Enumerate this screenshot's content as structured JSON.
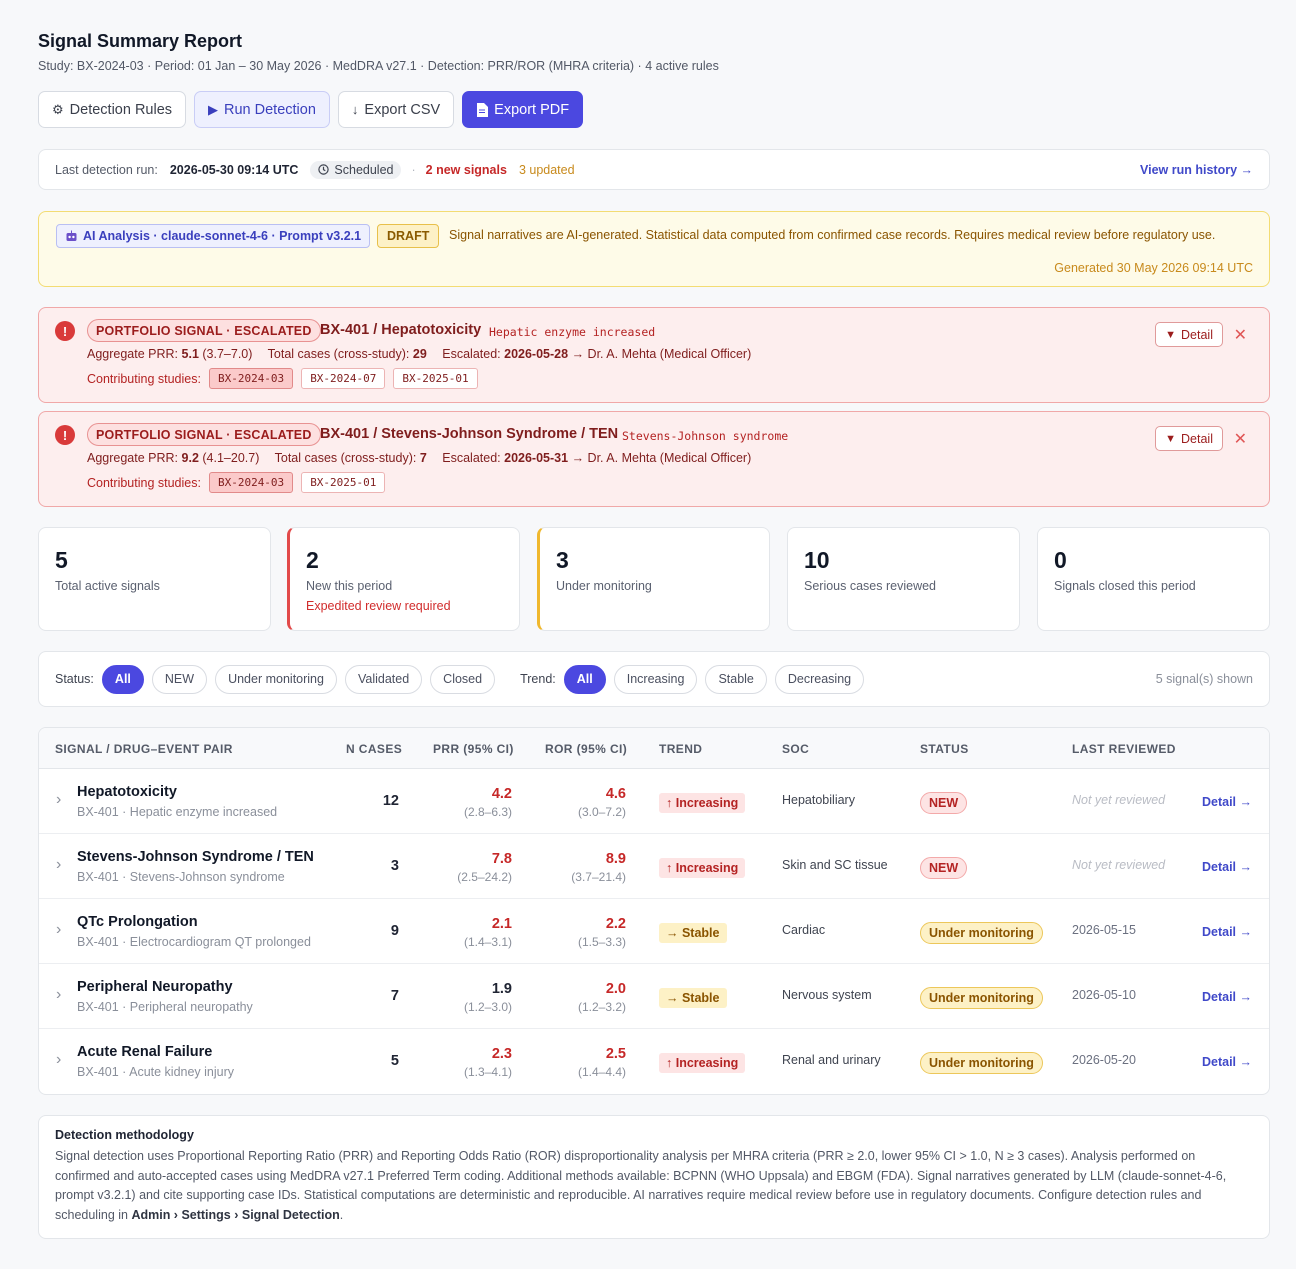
{
  "header": {
    "title": "Signal Summary Report",
    "subtitle": "Study: BX-2024-03  ·  Period: 01 Jan – 30 May 2026  ·  MedDRA v27.1  ·  Detection: PRR/ROR (MHRA criteria) · 4 active rules"
  },
  "toolbar": {
    "detection_rules": "Detection Rules",
    "run_detection": "Run Detection",
    "export_csv": "Export CSV",
    "export_pdf": "Export PDF"
  },
  "run": {
    "label": "Last detection run:",
    "timestamp": "2026-05-30 09:14 UTC",
    "mode": "Scheduled",
    "new_signals": "2 new signals",
    "updated": "3 updated",
    "history": "View run history →"
  },
  "ai_banner": {
    "tag": "AI Analysis · claude-sonnet-4-6 · Prompt v3.2.1",
    "draft": "DRAFT",
    "text": "Signal narratives are AI-generated. Statistical data computed from confirmed case records. Requires medical review before regulatory use.",
    "generated": "Generated 30 May 2026 09:14 UTC"
  },
  "escalations": [
    {
      "badge": "PORTFOLIO SIGNAL · ESCALATED",
      "title": "BX-401 / Hepatotoxicity",
      "term": "Hepatic enzyme increased",
      "prr_label": "Aggregate PRR:",
      "prr": "5.1",
      "prr_ci": "(3.7–7.0)",
      "cases_label": "Total cases (cross-study):",
      "cases": "29",
      "esc_label": "Escalated:",
      "esc_date": "2026-05-28",
      "esc_to": "→ Dr. A. Mehta (Medical Officer)",
      "studies_label": "Contributing studies:",
      "studies": [
        "BX-2024-03",
        "BX-2024-07",
        "BX-2025-01"
      ],
      "detail": "Detail"
    },
    {
      "badge": "PORTFOLIO SIGNAL · ESCALATED",
      "title": "BX-401 / Stevens-Johnson Syndrome / TEN",
      "term": "Stevens-Johnson syndrome",
      "prr_label": "Aggregate PRR:",
      "prr": "9.2",
      "prr_ci": "(4.1–20.7)",
      "cases_label": "Total cases (cross-study):",
      "cases": "7",
      "esc_label": "Escalated:",
      "esc_date": "2026-05-31",
      "esc_to": "→ Dr. A. Mehta (Medical Officer)",
      "studies_label": "Contributing studies:",
      "studies": [
        "BX-2024-03",
        "BX-2025-01"
      ],
      "detail": "Detail"
    }
  ],
  "stats": [
    {
      "value": "5",
      "label": "Total active signals",
      "sub": ""
    },
    {
      "value": "2",
      "label": "New this period",
      "sub": "Expedited review required"
    },
    {
      "value": "3",
      "label": "Under monitoring",
      "sub": ""
    },
    {
      "value": "10",
      "label": "Serious cases reviewed",
      "sub": ""
    },
    {
      "value": "0",
      "label": "Signals closed this period",
      "sub": ""
    }
  ],
  "filters": {
    "status_label": "Status:",
    "status": [
      "All",
      "NEW",
      "Under monitoring",
      "Validated",
      "Closed"
    ],
    "trend_label": "Trend:",
    "trend": [
      "All",
      "Increasing",
      "Stable",
      "Decreasing"
    ],
    "count": "5 signal(s) shown"
  },
  "table": {
    "headers": [
      "SIGNAL / DRUG–EVENT PAIR",
      "N CASES",
      "PRR (95% CI)",
      "ROR (95% CI)",
      "TREND",
      "SOC",
      "STATUS",
      "LAST REVIEWED"
    ],
    "rows": [
      {
        "name": "Hepatotoxicity",
        "sub": "BX-401 · Hepatic enzyme increased",
        "cases": "12",
        "prr": "4.2",
        "prr_ci": "(2.8–6.3)",
        "ror": "4.6",
        "ror_ci": "(3.0–7.2)",
        "trend": "↑ Increasing",
        "soc": "Hepatobiliary",
        "status": "NEW",
        "reviewed": "Not yet reviewed",
        "detail": "Detail →"
      },
      {
        "name": "Stevens-Johnson Syndrome / TEN",
        "sub": "BX-401 · Stevens-Johnson syndrome",
        "cases": "3",
        "prr": "7.8",
        "prr_ci": "(2.5–24.2)",
        "ror": "8.9",
        "ror_ci": "(3.7–21.4)",
        "trend": "↑ Increasing",
        "soc": "Skin and SC tissue",
        "status": "NEW",
        "reviewed": "Not yet reviewed",
        "detail": "Detail →"
      },
      {
        "name": "QTc Prolongation",
        "sub": "BX-401 · Electrocardiogram QT prolonged",
        "cases": "9",
        "prr": "2.1",
        "prr_ci": "(1.4–3.1)",
        "ror": "2.2",
        "ror_ci": "(1.5–3.3)",
        "trend": "→ Stable",
        "soc": "Cardiac",
        "status": "Under monitoring",
        "reviewed": "2026-05-15",
        "detail": "Detail →"
      },
      {
        "name": "Peripheral Neuropathy",
        "sub": "BX-401 · Peripheral neuropathy",
        "cases": "7",
        "prr": "1.9",
        "prr_ci": "(1.2–3.0)",
        "ror": "2.0",
        "ror_ci": "(1.2–3.2)",
        "trend": "→ Stable",
        "soc": "Nervous system",
        "status": "Under monitoring",
        "reviewed": "2026-05-10",
        "detail": "Detail →"
      },
      {
        "name": "Acute Renal Failure",
        "sub": "BX-401 · Acute kidney injury",
        "cases": "5",
        "prr": "2.3",
        "prr_ci": "(1.3–4.1)",
        "ror": "2.5",
        "ror_ci": "(1.4–4.4)",
        "trend": "↑ Increasing",
        "soc": "Renal and urinary",
        "status": "Under monitoring",
        "reviewed": "2026-05-20",
        "detail": "Detail →"
      }
    ]
  },
  "methodology": {
    "title": "Detection methodology",
    "text": "Signal detection uses Proportional Reporting Ratio (PRR) and Reporting Odds Ratio (ROR) disproportionality analysis per MHRA criteria (PRR ≥ 2.0, lower 95% CI > 1.0, N ≥ 3 cases). Analysis performed on confirmed and auto-accepted cases using MedDRA v27.1 Preferred Term coding. Additional methods available: BCPNN (WHO Uppsala) and EBGM (FDA). Signal narratives generated by LLM (claude-sonnet-4-6, prompt v3.2.1) and cite supporting case IDs. Statistical computations are deterministic and reproducible. AI narratives require medical review before use in regulatory documents. Configure detection rules and scheduling in",
    "path": "Admin › Settings › Signal Detection",
    "end": "."
  }
}
